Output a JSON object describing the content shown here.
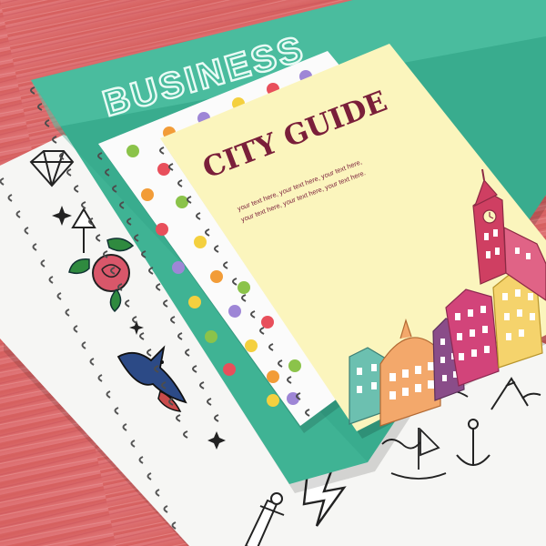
{
  "colors": {
    "background": "#d9666b",
    "business_cover": "#3fb394",
    "city_guide_cover": "#fbf5bd",
    "title_text": "#7a1f3a"
  },
  "notebooks": {
    "business": {
      "title": "BUSINESS"
    },
    "city_guide": {
      "title": "CITY GUIDE",
      "blurb_line1": "your text here, your text here, your text here,",
      "blurb_line2": "your text here, your text here, your text here."
    }
  },
  "icons": [
    "diamond-icon",
    "star-icon",
    "arrow-icon",
    "rose-icon",
    "swallow-icon",
    "lightning-icon",
    "clock-tower-icon",
    "dome-building-icon"
  ]
}
